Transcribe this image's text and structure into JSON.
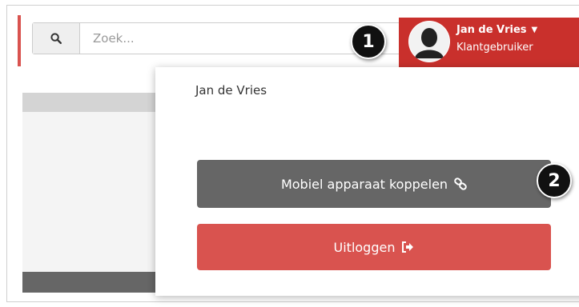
{
  "search": {
    "placeholder": "Zoek..."
  },
  "user": {
    "name": "Jan de Vries",
    "role": "Klantgebruiker"
  },
  "dropdown": {
    "user_name": "Jan de Vries",
    "link_device_label": "Mobiel apparaat koppelen",
    "logout_label": "Uitloggen"
  },
  "callouts": {
    "one": "1",
    "two": "2"
  },
  "icons": {
    "search": "search-icon",
    "avatar": "user-silhouette-icon",
    "caret": "caret-down-icon",
    "link": "link-icon",
    "logout": "sign-out-icon"
  },
  "colors": {
    "accent_red": "#c9302c",
    "logout_red": "#d9534f",
    "dark_gray_button": "#666666",
    "callout_black": "#111111"
  }
}
